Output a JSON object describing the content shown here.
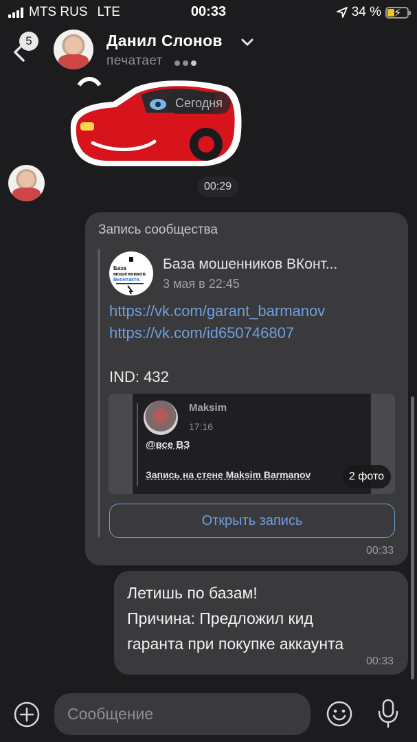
{
  "status_bar": {
    "carrier": "MTS RUS",
    "network": "LTE",
    "time": "00:33",
    "battery_text": "34 %",
    "battery_level": 0.34
  },
  "header": {
    "back_badge": "5",
    "contact_name": "Данил Слонов",
    "status": "печатает"
  },
  "chat": {
    "date_divider": "Сегодня",
    "sticker_time": "00:29",
    "shared_post": {
      "header": "Запись сообщества",
      "community_name": "База мошенников ВКонт...",
      "community_logo_text": [
        "База",
        "мошенников",
        "Вконтакте."
      ],
      "date": "3 мая в 22:45",
      "links": [
        "https://vk.com/garant_barmanov",
        "https://vk.com/id650746807"
      ],
      "text": "IND: 432",
      "photo_preview": {
        "author": "Maksim",
        "time": "17:16",
        "mention": "@все ВЗ",
        "wall_text": "Запись на стене Maksim Barmanov"
      },
      "photo_count": "2 фото",
      "open_button": "Открыть запись",
      "time": "00:33"
    },
    "outgoing_message": {
      "lines": [
        "Летишь по базам!",
        "Причина: Предложил кид",
        "гаранта при покупке аккаунта"
      ],
      "time": "00:33"
    }
  },
  "composer": {
    "placeholder": "Сообщение"
  },
  "colors": {
    "background": "#1c1c1e",
    "bubble": "#3a3a3c",
    "link": "#6f9fe0",
    "muted": "#8d8d93"
  },
  "icons": [
    "signal-icon",
    "location-arrow-icon",
    "battery-icon",
    "back-chevron-icon",
    "chevron-down-icon",
    "plus-icon",
    "emoji-icon",
    "microphone-icon"
  ]
}
